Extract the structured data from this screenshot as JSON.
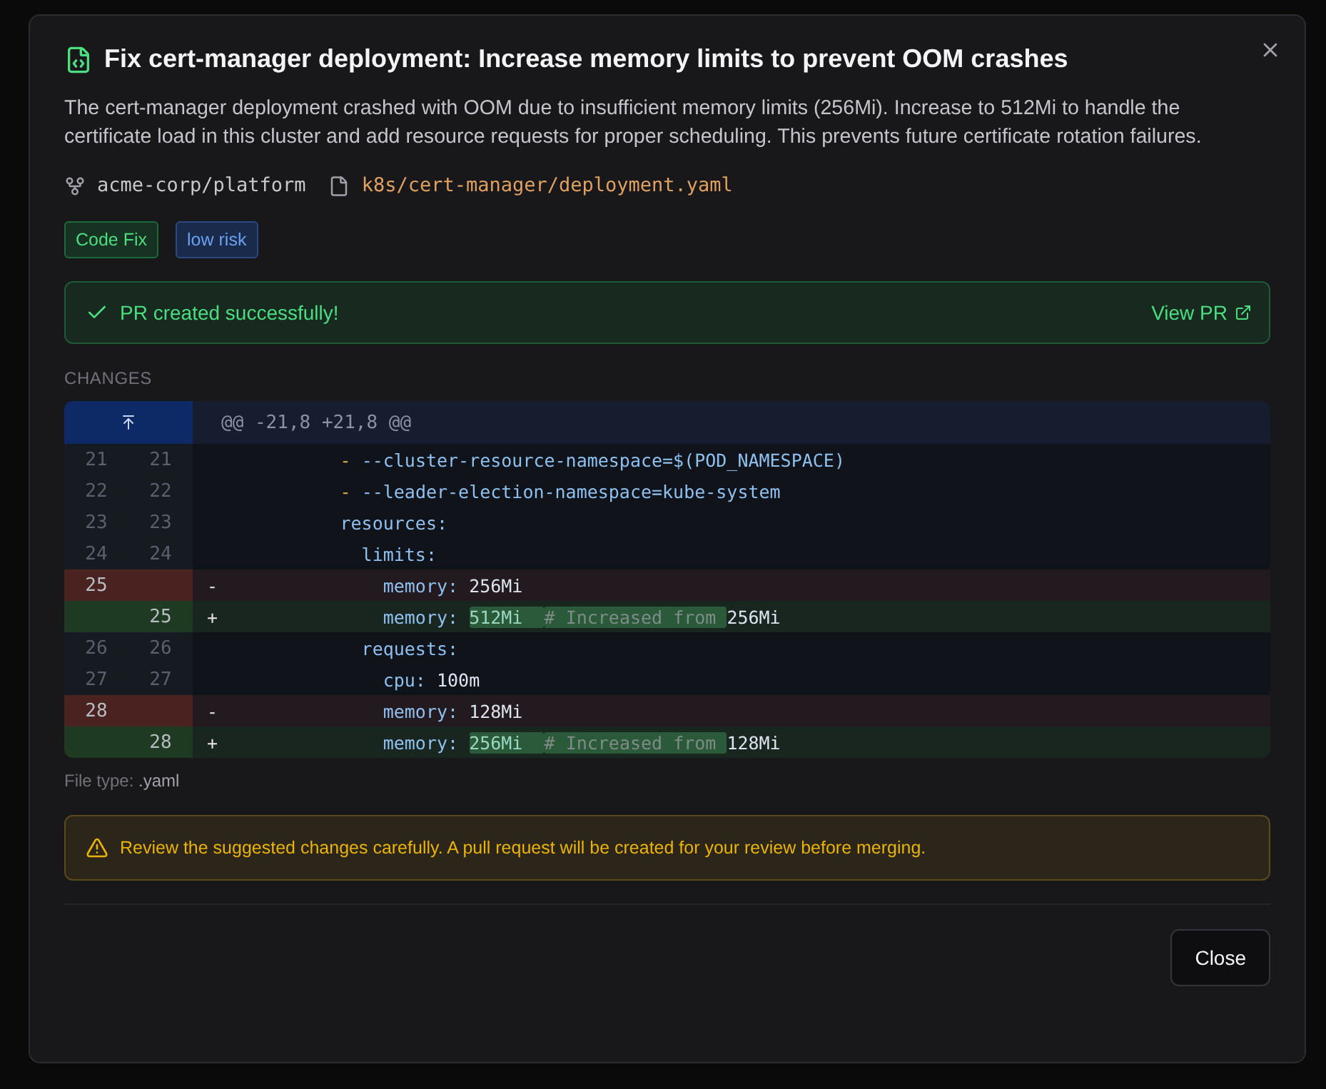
{
  "dialog": {
    "title": "Fix cert-manager deployment: Increase memory limits to prevent OOM crashes",
    "description": "The cert-manager deployment crashed with OOM due to insufficient memory limits (256Mi). Increase to 512Mi to handle the certificate load in this cluster and add resource requests for proper scheduling. This prevents future certificate rotation failures.",
    "repo": "acme-corp/platform",
    "file": "k8s/cert-manager/deployment.yaml",
    "tags": [
      {
        "label": "Code Fix",
        "kind": "type"
      },
      {
        "label": "low risk",
        "kind": "risk"
      }
    ],
    "success": {
      "message": "PR created successfully!",
      "link": "View PR"
    },
    "changes_label": "CHANGES",
    "diff": {
      "hunk": "@@ -21,8 +21,8 @@",
      "lines": [
        {
          "kind": "context",
          "old": "21",
          "new": "21",
          "tokens": [
            {
              "kind": "dash",
              "t": "          - "
            },
            {
              "kind": "key",
              "t": "--cluster-resource-namespace=$(POD_NAMESPACE)"
            }
          ]
        },
        {
          "kind": "context",
          "old": "22",
          "new": "22",
          "tokens": [
            {
              "kind": "dash",
              "t": "          - "
            },
            {
              "kind": "key",
              "t": "--leader-election-namespace=kube-system"
            }
          ]
        },
        {
          "kind": "context",
          "old": "23",
          "new": "23",
          "tokens": [
            {
              "kind": "key",
              "t": "          resources:"
            }
          ]
        },
        {
          "kind": "context",
          "old": "24",
          "new": "24",
          "tokens": [
            {
              "kind": "key",
              "t": "            limits:"
            }
          ]
        },
        {
          "kind": "del",
          "old": "25",
          "sign": "-",
          "tokens": [
            {
              "kind": "key",
              "t": "              memory: "
            },
            {
              "kind": "value",
              "t": "256Mi"
            }
          ]
        },
        {
          "kind": "add",
          "new": "25",
          "sign": "+",
          "tokens": [
            {
              "kind": "key",
              "t": "              memory: "
            },
            {
              "kind": "changed",
              "t": "512Mi  "
            },
            {
              "kind": "changed_comment",
              "t": "# Increased from "
            },
            {
              "kind": "value",
              "t": "256Mi"
            }
          ]
        },
        {
          "kind": "context",
          "old": "26",
          "new": "26",
          "tokens": [
            {
              "kind": "key",
              "t": "            requests:"
            }
          ]
        },
        {
          "kind": "context",
          "old": "27",
          "new": "27",
          "tokens": [
            {
              "kind": "key",
              "t": "              cpu: "
            },
            {
              "kind": "value",
              "t": "100m"
            }
          ]
        },
        {
          "kind": "del",
          "old": "28",
          "sign": "-",
          "tokens": [
            {
              "kind": "key",
              "t": "              memory: "
            },
            {
              "kind": "value",
              "t": "128Mi"
            }
          ]
        },
        {
          "kind": "add",
          "new": "28",
          "sign": "+",
          "tokens": [
            {
              "kind": "key",
              "t": "              memory: "
            },
            {
              "kind": "changed",
              "t": "256Mi  "
            },
            {
              "kind": "changed_comment",
              "t": "# Increased from "
            },
            {
              "kind": "value",
              "t": "128Mi"
            }
          ]
        }
      ]
    },
    "file_type": {
      "label": "File type:",
      "value": ".yaml"
    },
    "warning": "Review the suggested changes carefully. A pull request will be created for your review before merging.",
    "close_button": "Close"
  }
}
